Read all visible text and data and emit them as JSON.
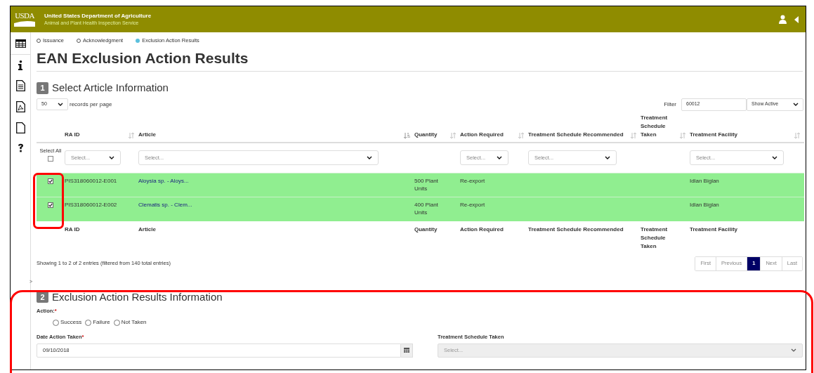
{
  "header": {
    "agency": "United States Department of Agriculture",
    "service": "Animal and Plant Health Inspection Service",
    "logo": "USDA"
  },
  "steps": [
    {
      "label": "Issuance",
      "selected": false
    },
    {
      "label": "Acknowledgment",
      "selected": false
    },
    {
      "label": "Exclusion Action Results",
      "selected": true
    }
  ],
  "title": "EAN Exclusion Action Results",
  "section_1": {
    "number": "1",
    "heading": "Select Article Information",
    "page_size": "50",
    "page_size_label": "records per page",
    "filter_label": "Filter",
    "filter_value": "60012",
    "status_filter": "Show Active"
  },
  "table": {
    "select_all_label": "Select All",
    "select_all_checked": false,
    "columns": [
      {
        "label": "RA ID",
        "sorted": false,
        "filter": "Select..."
      },
      {
        "label": "Article",
        "sorted": true,
        "filter": "Select..."
      },
      {
        "label": "Quantity",
        "sorted": false
      },
      {
        "label": "Action Required",
        "sorted": false,
        "filter": "Select..."
      },
      {
        "label": "Treatment Schedule Recommended",
        "sorted": false,
        "filter": "Select..."
      },
      {
        "label": "Treatment Schedule Taken",
        "sorted": false
      },
      {
        "label": "Treatment Facility",
        "sorted": false,
        "filter": "Select..."
      }
    ],
    "rows": [
      {
        "checked": true,
        "ra_id": "PIS318060012-E001",
        "article": "Aloysia sp. - Aloys...",
        "quantity": "500 Plant Units",
        "action_required": "Re-export",
        "treatment_facility": "Idlan Biglan"
      },
      {
        "checked": true,
        "ra_id": "PIS318060012-E002",
        "article": "Clematis sp. - Clem...",
        "quantity": "400 Plant Units",
        "action_required": "Re-export",
        "treatment_facility": "Idlan Biglan"
      }
    ],
    "footer": [
      "RA ID",
      "Article",
      "Quantity",
      "Action Required",
      "Treatment Schedule Recommended",
      "Treatment Schedule Taken",
      "Treatment Facility"
    ],
    "info": "Showing 1 to 2 of 2 entries (filtered from 140 total entries)",
    "pagination": [
      {
        "label": "First",
        "selected": false
      },
      {
        "label": "Previous",
        "selected": false
      },
      {
        "label": "1",
        "selected": true
      },
      {
        "label": "Next",
        "selected": false
      },
      {
        "label": "Last",
        "selected": false
      }
    ]
  },
  "collapse_marker": ">",
  "section_2": {
    "number": "2",
    "heading": "Exclusion Action Results Information",
    "action_label": "Action:",
    "required_mark": "*",
    "actions": [
      {
        "label": "Success",
        "checked": false
      },
      {
        "label": "Failure",
        "checked": false
      },
      {
        "label": "Not Taken",
        "checked": false
      }
    ],
    "date_label": "Date Action Taken",
    "date_value": "09/10/2018",
    "schedule_label": "Treatment Schedule Taken",
    "schedule_placeholder": "Select...",
    "schedule_disabled": true
  }
}
